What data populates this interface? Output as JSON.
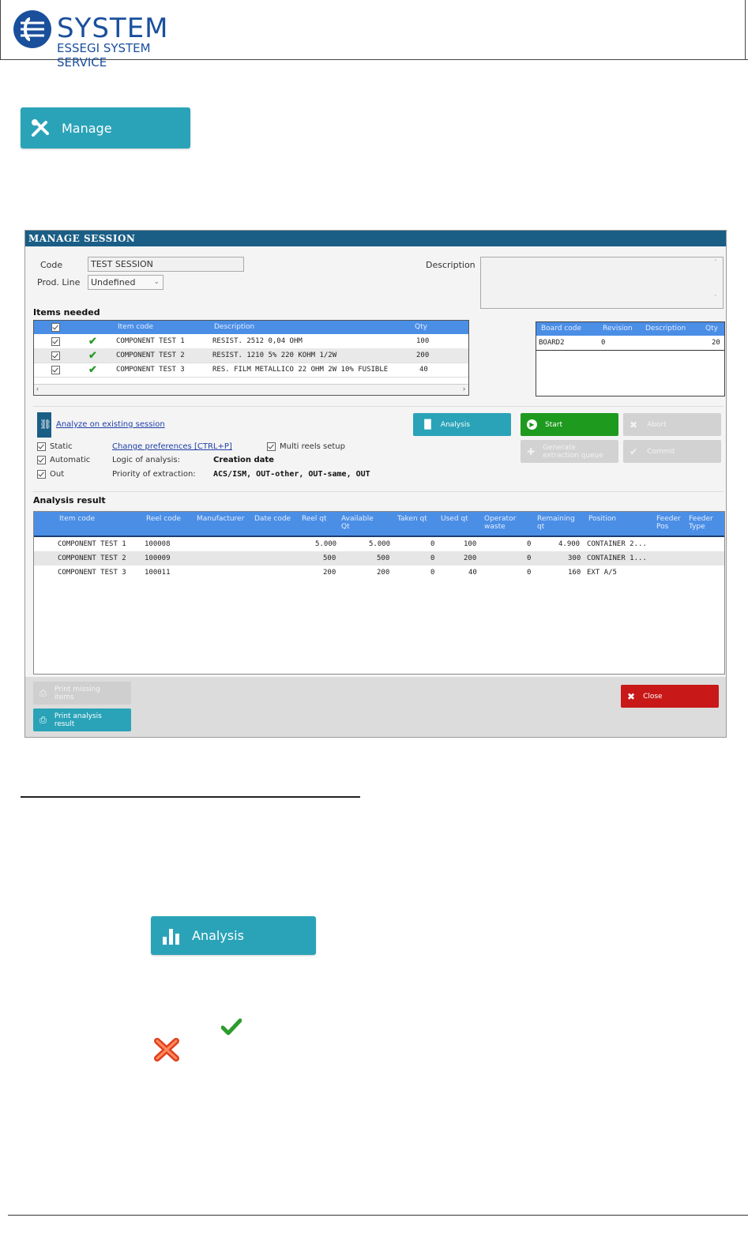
{
  "header": {
    "logo_word": "SYSTEM",
    "logo_sub": "ESSEGI SYSTEM SERVICE"
  },
  "manage_button": {
    "label": "Manage",
    "icon": "tools-icon"
  },
  "window": {
    "title": "MANAGE SESSION",
    "code_label": "Code",
    "code_value": "TEST SESSION",
    "prod_line_label": "Prod. Line",
    "prod_line_value": "Undefined",
    "description_label": "Description",
    "items_needed_label": "Items needed",
    "items_headers": [
      "",
      "",
      "Item code",
      "Description",
      "Qty"
    ],
    "items_rows": [
      {
        "code": "COMPONENT TEST 1",
        "desc": "RESIST. 2512 0,04 OHM",
        "qty": "100"
      },
      {
        "code": "COMPONENT TEST 2",
        "desc": "RESIST. 1210 5% 220 KOHM  1/2W",
        "qty": "200"
      },
      {
        "code": "COMPONENT TEST 3",
        "desc": "RES. FILM METALLICO 22 OHM 2W 10% FUSIBLE",
        "qty": "40"
      }
    ],
    "board_headers": [
      "Board code",
      "Revision",
      "Description",
      "Qty"
    ],
    "board_rows": [
      {
        "code": "BOARD2",
        "rev": "0",
        "desc": "",
        "qty": "20"
      }
    ],
    "analyze_link": "Analyze on existing session",
    "analysis_btn": "Analysis",
    "start_btn": "Start",
    "abort_btn": "Abort",
    "gen_queue_btn": "Generate extraction queue",
    "commit_btn": "Commit",
    "static_label": "Static",
    "automatic_label": "Automatic",
    "out_label": "Out",
    "change_pref_link": "Change preferences  [CTRL+P]",
    "multi_reels_label": "Multi reels setup",
    "logic_label": "Logic of analysis:",
    "logic_value": "Creation date",
    "priority_label": "Priority of extraction:",
    "priority_value": "ACS/ISM, OUT-other, OUT-same, OUT",
    "analysis_result_label": "Analysis result",
    "result_headers": [
      "",
      "Item code",
      "Reel code",
      "Manufacturer",
      "Date code",
      "Reel qt",
      "Available Qt",
      "Taken qt",
      "Used qt",
      "Operator waste",
      "Remaining qt",
      "Position",
      "Feeder Pos",
      "Feeder Type"
    ],
    "result_rows": [
      {
        "item": "COMPONENT TEST 1",
        "reel": "100008",
        "reel_qt": "5.000",
        "avail": "5.000",
        "taken": "0",
        "used": "100",
        "waste": "0",
        "remain": "4.900",
        "pos": "CONTAINER 2..."
      },
      {
        "item": "COMPONENT TEST 2",
        "reel": "100009",
        "reel_qt": "500",
        "avail": "500",
        "taken": "0",
        "used": "200",
        "waste": "0",
        "remain": "300",
        "pos": "CONTAINER 1..."
      },
      {
        "item": "COMPONENT TEST 3",
        "reel": "100011",
        "reel_qt": "200",
        "avail": "200",
        "taken": "0",
        "used": "40",
        "waste": "0",
        "remain": "160",
        "pos": "EXT A/5"
      }
    ],
    "print_missing_btn": "Print missing items",
    "print_analysis_btn": "Print analysis result",
    "close_btn": "Close"
  },
  "analysis_button": {
    "label": "Analysis",
    "icon": "bar-chart-icon"
  },
  "colors": {
    "teal": "#2aa3b8",
    "title_bar": "#1a5e86",
    "table_header": "#4a8ee6",
    "start_green": "#1e9a1e",
    "close_red": "#c81818"
  }
}
